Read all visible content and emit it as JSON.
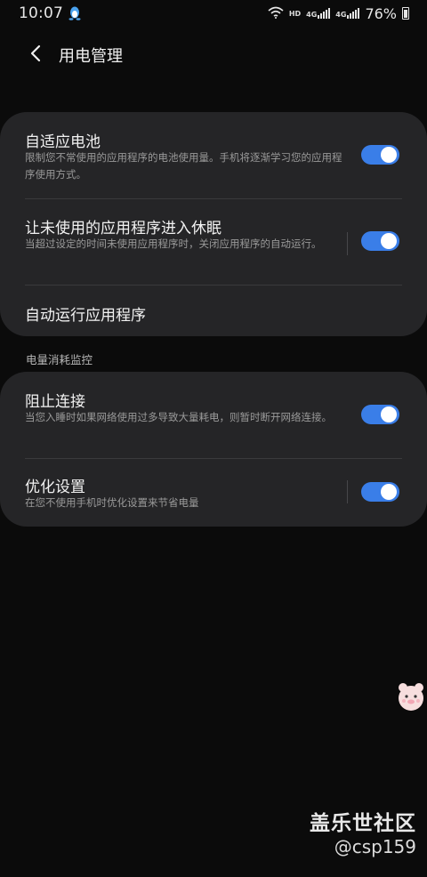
{
  "status_bar": {
    "time": "10:07",
    "network_hd": "HD",
    "network_4g_1": "4G",
    "network_4g_2": "4G",
    "battery_percent": "76%"
  },
  "header": {
    "title": "用电管理"
  },
  "card1": {
    "adaptive_battery": {
      "title": "自适应电池",
      "subtitle": "限制您不常使用的应用程序的电池使用量。手机将逐渐学习您的应用程序使用方式。",
      "enabled": true
    },
    "sleep_unused": {
      "title": "让未使用的应用程序进入休眠",
      "subtitle": "当超过设定的时间未使用应用程序时，关闭应用程序的自动运行。",
      "enabled": true
    },
    "auto_run": {
      "title": "自动运行应用程序"
    }
  },
  "section": {
    "label": "电量消耗监控"
  },
  "card2": {
    "block_connection": {
      "title": "阻止连接",
      "subtitle": "当您入睡时如果网络使用过多导致大量耗电，则暂时断开网络连接。",
      "enabled": true
    },
    "optimize_settings": {
      "title": "优化设置",
      "subtitle": "在您不使用手机时优化设置来节省电量",
      "enabled": true
    }
  },
  "watermark": {
    "brand": "盖乐世社区",
    "user": "@csp159"
  },
  "colors": {
    "accent": "#3a7ee8",
    "card_bg": "#252527",
    "page_bg": "#0b0b0b"
  }
}
